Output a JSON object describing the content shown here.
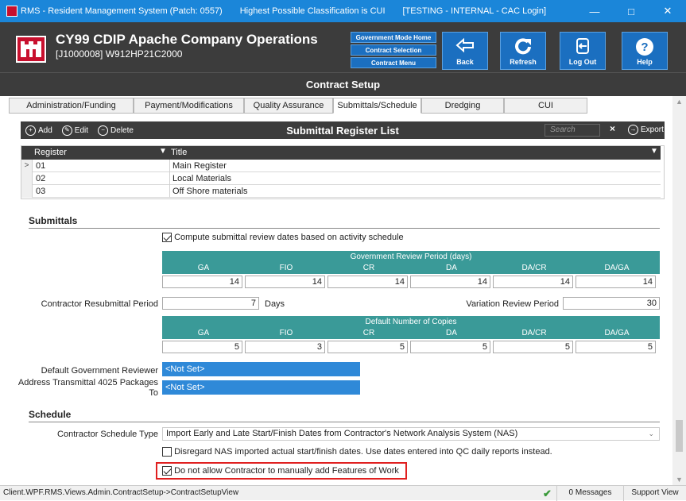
{
  "window": {
    "title": "RMS - Resident Management System (Patch: 0557)",
    "classification": "Highest Possible Classification is CUI",
    "env": "[TESTING - INTERNAL - CAC Login]"
  },
  "header": {
    "title": "CY99 CDIP Apache Company Operations",
    "subtitle": "[J1000008] W912HP21C2000",
    "mode_buttons": [
      "Government Mode Home",
      "Contract Selection",
      "Contract Menu"
    ],
    "buttons": [
      {
        "label": "Back",
        "icon": "back-arrow-icon"
      },
      {
        "label": "Refresh",
        "icon": "refresh-icon"
      },
      {
        "label": "Log Out",
        "icon": "logout-icon"
      },
      {
        "label": "Help",
        "icon": "help-icon"
      }
    ]
  },
  "section_title": "Contract Setup",
  "tabs": [
    {
      "label": "Administration/Funding"
    },
    {
      "label": "Payment/Modifications"
    },
    {
      "label": "Quality Assurance"
    },
    {
      "label": "Submittals/Schedule"
    },
    {
      "label": "Dredging"
    },
    {
      "label": "CUI"
    }
  ],
  "register_toolbar": {
    "add": "Add",
    "edit": "Edit",
    "delete": "Delete",
    "title": "Submittal Register List",
    "search_placeholder": "Search",
    "clear": "×",
    "export": "Export"
  },
  "register_grid": {
    "columns": [
      "Register",
      "Title"
    ],
    "rows": [
      {
        "register": "01",
        "title": "Main Register"
      },
      {
        "register": "02",
        "title": "Local Materials"
      },
      {
        "register": "03",
        "title": "Off Shore materials"
      }
    ]
  },
  "submittals": {
    "heading": "Submittals",
    "compute_label": "Compute submittal review dates based on activity schedule",
    "review_header": "Government Review Period (days)",
    "columns": [
      "GA",
      "FIO",
      "CR",
      "DA",
      "DA/CR",
      "DA/GA"
    ],
    "review_values": [
      "14",
      "14",
      "14",
      "14",
      "14",
      "14"
    ],
    "resubmittal_label": "Contractor Resubmittal Period",
    "resubmittal_value": "7",
    "days_label": "Days",
    "variation_label": "Variation Review Period",
    "variation_value": "30",
    "copies_header": "Default Number of Copies",
    "copies_values": [
      "5",
      "3",
      "5",
      "5",
      "5",
      "5"
    ],
    "reviewer_label": "Default Government Reviewer",
    "reviewer_value": "<Not Set>",
    "transmittal_label_1": "Address Transmittal 4025 Packages",
    "transmittal_label_2": "To",
    "transmittal_value": "<Not Set>"
  },
  "schedule": {
    "heading": "Schedule",
    "type_label": "Contractor Schedule Type",
    "type_value": "Import Early and Late Start/Finish Dates from Contractor's Network Analysis System (NAS)",
    "disregard_label": "Disregard NAS imported actual start/finish dates. Use dates entered into QC daily reports instead.",
    "no_add_label": "Do not allow Contractor to manually add Features of Work"
  },
  "statusbar": {
    "path": "Client.WPF.RMS.Views.Admin.ContractSetup->ContractSetupView",
    "messages": "0 Messages",
    "support": "Support View"
  }
}
